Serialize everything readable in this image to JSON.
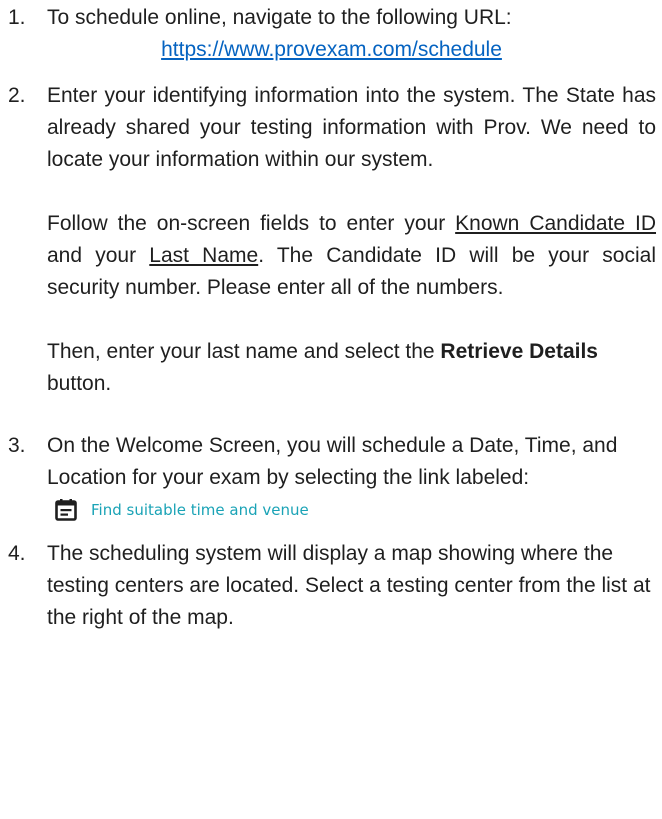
{
  "steps": [
    {
      "number": "1.",
      "text": "To schedule online, navigate to the following URL:",
      "url": "https://www.provexam.com/schedule"
    },
    {
      "number": "2.",
      "para1": "Enter your identifying information into the system. The State has already shared your testing information with Prov.  We need to locate your information within our system.",
      "para2_a": "Follow the on-screen fields to enter your ",
      "para2_link1": "Known Candidate ID",
      "para2_b": " and your ",
      "para2_link2": "Last Name",
      "para2_c": ".  The Candidate ID will be your social security number.  Please enter all of the numbers.",
      "para3_a": "Then, enter your last name and select the ",
      "para3_bold": "Retrieve Details",
      "para3_b": " button."
    },
    {
      "number": "3.",
      "text": "On the Welcome Screen, you will schedule a Date, Time, and Location for your exam by selecting the link labeled:",
      "link_label": "Find suitable time and venue",
      "link_icon": "calendar-icon",
      "link_color": "#1aa3b6"
    },
    {
      "number": "4.",
      "text": "The scheduling system will display a map showing where the testing centers are located.  Select a testing center from the list at the right of the map."
    }
  ],
  "colors": {
    "url": "#0563c1",
    "text": "#1f1f1f"
  }
}
